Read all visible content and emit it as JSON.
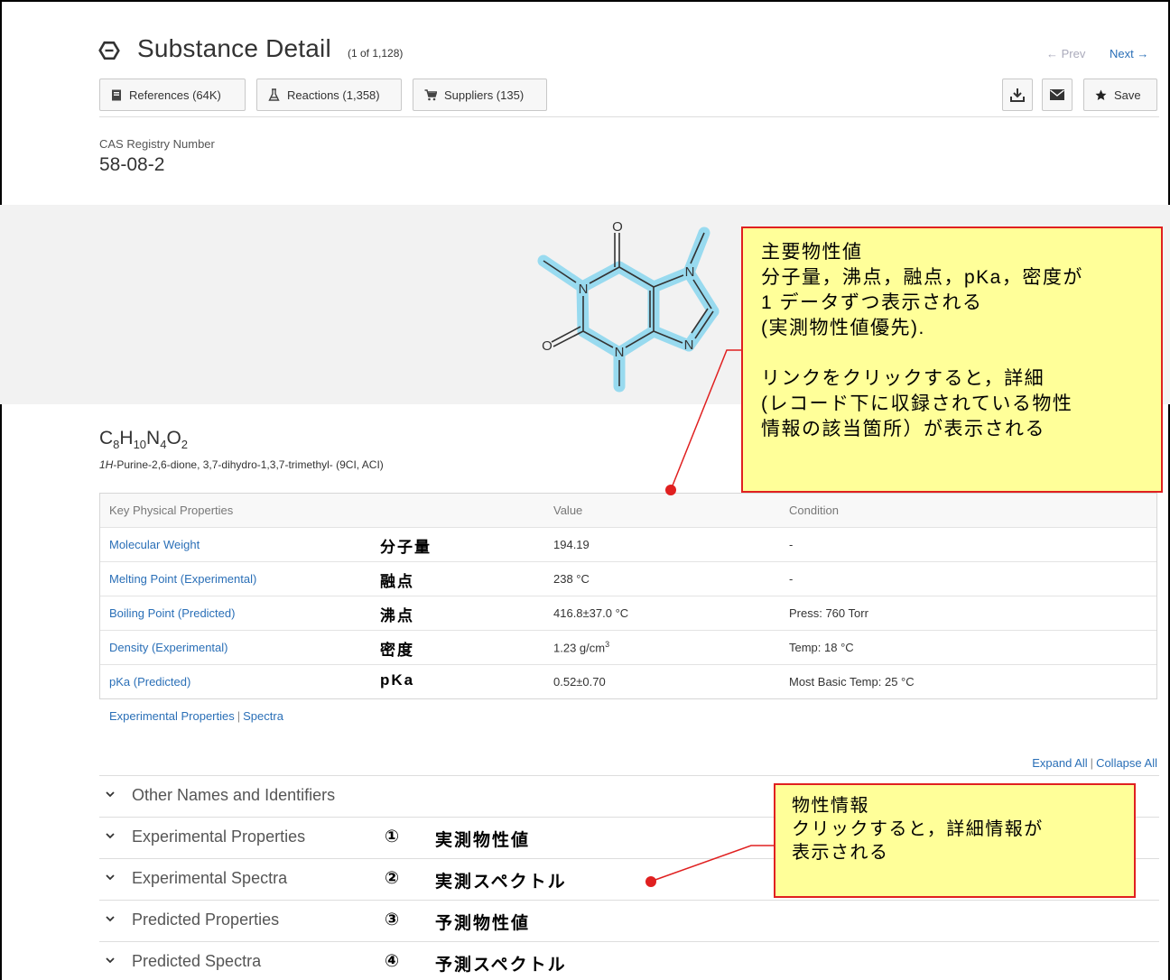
{
  "header": {
    "title": "Substance Detail",
    "count": "(1 of 1,128)",
    "prev": "← Prev",
    "next": "Next →"
  },
  "toolbar": {
    "references": "References (64K)",
    "reactions": "Reactions (1,358)",
    "suppliers": "Suppliers (135)",
    "save": "Save"
  },
  "cas": {
    "label": "CAS Registry Number",
    "number": "58-08-2"
  },
  "structure": {
    "atoms": [
      "O",
      "N",
      "N",
      "O",
      "N",
      "N"
    ]
  },
  "substance": {
    "formula_parts": [
      "C",
      "8",
      "H",
      "10",
      "N",
      "4",
      "O",
      "2"
    ],
    "name_italic": "1H",
    "name_rest": "-Purine-2,6-dione, 3,7-dihydro-1,3,7-trimethyl- (9CI, ACI)"
  },
  "properties": {
    "headers": [
      "Key Physical Properties",
      "Value",
      "Condition"
    ],
    "rows": [
      {
        "name": "Molecular Weight",
        "jp": "分子量",
        "value": "194.19",
        "condition": "-"
      },
      {
        "name": "Melting Point (Experimental)",
        "jp": "融点",
        "value": "238 °C",
        "condition": "-"
      },
      {
        "name": "Boiling Point (Predicted)",
        "jp": "沸点",
        "value": "416.8±37.0 °C",
        "condition": "Press: 760 Torr"
      },
      {
        "name": "Density (Experimental)",
        "jp": "密度",
        "value_main": "1.23 g/cm",
        "value_sup": "3",
        "condition": "Temp: 18 °C"
      },
      {
        "name": "pKa (Predicted)",
        "jp": "pKa",
        "value": "0.52±0.70",
        "condition": "Most Basic Temp: 25 °C"
      }
    ],
    "links": [
      "Experimental Properties",
      "Spectra"
    ]
  },
  "sections": {
    "expand_all": "Expand All",
    "collapse_all": "Collapse All",
    "items": [
      {
        "label": "Other Names and Identifiers",
        "num": "",
        "jp": ""
      },
      {
        "label": "Experimental Properties",
        "num": "①",
        "jp": "実測物性値"
      },
      {
        "label": "Experimental Spectra",
        "num": "②",
        "jp": "実測スペクトル"
      },
      {
        "label": "Predicted Properties",
        "num": "③",
        "jp": "予測物性値"
      },
      {
        "label": "Predicted Spectra",
        "num": "④",
        "jp": "予測スペクトル"
      }
    ]
  },
  "callouts": {
    "note1_lines": [
      "主要物性値",
      "分子量，沸点，融点，pKa，密度が",
      "1 データずつ表示される",
      "(実測物性値優先).",
      "",
      "リンクをクリックすると，詳細",
      "(レコード下に収録されている物性",
      "情報の該当箇所）が表示される"
    ],
    "note2_lines": [
      "物性情報",
      "クリックすると，詳細情報が",
      "表示される"
    ]
  },
  "colors": {
    "link": "#2a6fb7",
    "callout_bg": "#ffff99",
    "callout_border": "#e02020",
    "highlight": "#8fd8ef"
  }
}
